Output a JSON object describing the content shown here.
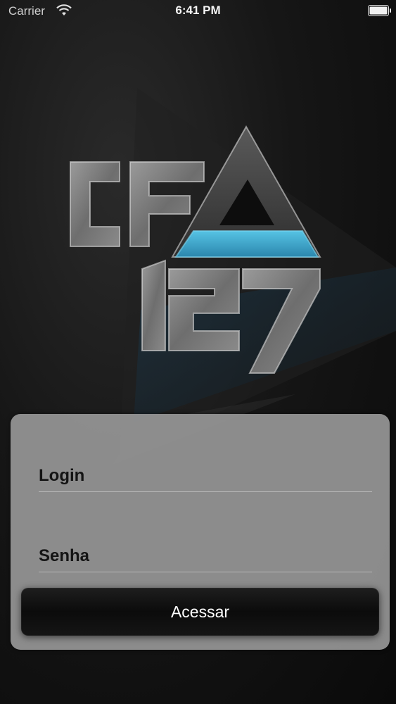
{
  "status_bar": {
    "carrier": "Carrier",
    "time": "6:41 PM",
    "wifi_icon": "wifi-icon",
    "battery_icon": "battery-icon"
  },
  "logo": {
    "icon": "cf-a-127-logo",
    "accent_color": "#3aa6c9"
  },
  "login_form": {
    "login_label": "Login",
    "login_value": "",
    "password_label": "Senha",
    "password_value": "",
    "submit_label": "Acessar"
  },
  "colors": {
    "card_background": "#969696",
    "button_background": "#111111",
    "accent": "#3aa6c9"
  }
}
